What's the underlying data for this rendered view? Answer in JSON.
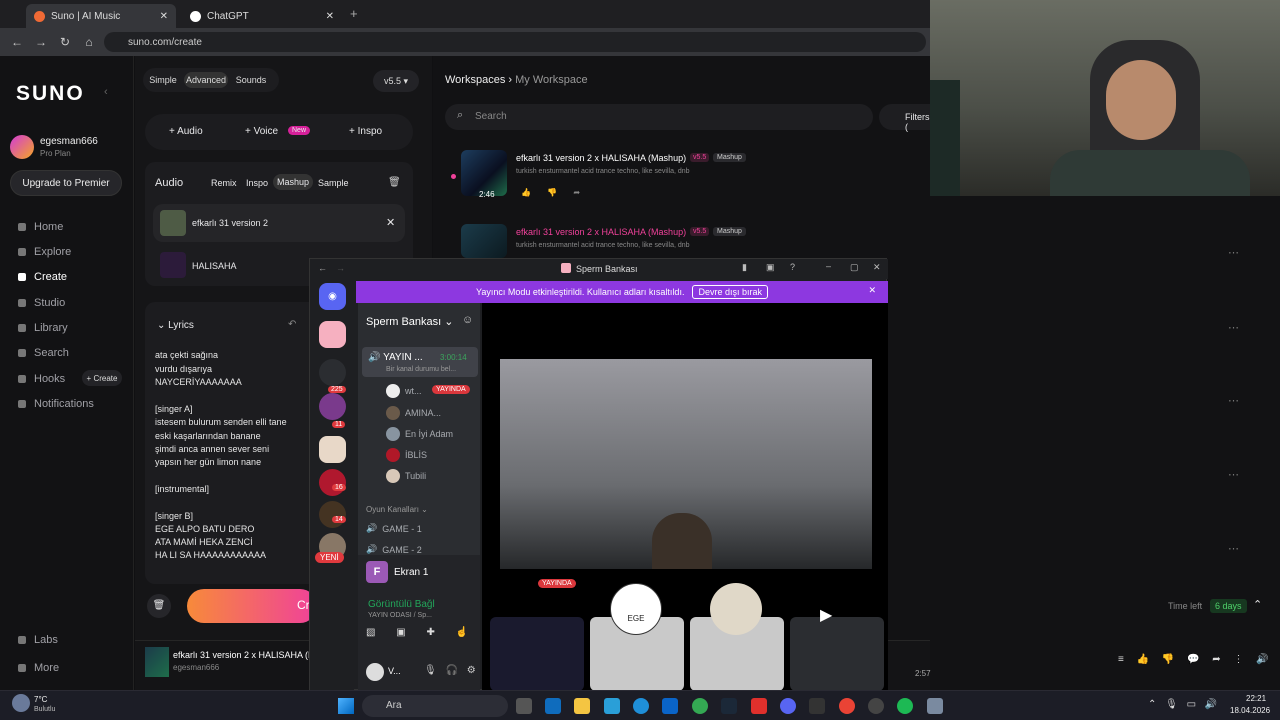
{
  "browser": {
    "tabs": [
      {
        "label": "Suno | AI Music"
      },
      {
        "label": "ChatGPT"
      }
    ],
    "url": "suno.com/create"
  },
  "suno": {
    "logo": "SUNO",
    "user": {
      "name": "egesman666",
      "plan": "Pro Plan"
    },
    "upgrade": "Upgrade to Premier",
    "nav": [
      "Home",
      "Explore",
      "Create",
      "Studio",
      "Library",
      "Search",
      "Hooks",
      "Notifications"
    ],
    "hooks_create": "+ Create",
    "labs": "Labs",
    "more": "More",
    "modes": [
      "Simple",
      "Advanced",
      "Sounds"
    ],
    "version": "v5.5",
    "add": {
      "audio": "+ Audio",
      "voice": "+ Voice",
      "voice_badge": "New",
      "inspo": "+ Inspo"
    },
    "audio_card": {
      "title": "Audio",
      "tabs": [
        "Remix",
        "Inspo",
        "Mashup",
        "Sample"
      ],
      "tracks": [
        "efkarlı 31 version 2",
        "HALISAHA"
      ]
    },
    "lyrics_title": "Lyrics",
    "lyrics": [
      "ata çekti sağına",
      "vurdu dışarıya",
      "NAYCERİYAAAAAAA",
      "",
      "[singer A]",
      "istesem bulurum senden elli tane",
      "eski kaşarlarından banane",
      "şimdi anca annen sever seni",
      "yapsın her gün limon nane",
      "",
      "[instrumental]",
      "",
      "[singer B]",
      "EGE ALPO BATU DERO",
      "ATA MAMİ HEKA ZENCİ",
      "HA LI SA HAAAAAAAAAAA"
    ],
    "create_btn": "Cr"
  },
  "workspace": {
    "crumb_root": "Workspaces",
    "crumb_current": "My Workspace",
    "search": "Search",
    "filters": "Filters (",
    "songs": [
      {
        "title": "efkarlı 31 version 2 x HALISAHA (Mashup)",
        "ver": "v5.5",
        "tag": "Mashup",
        "desc": "turkish ensturmantel acid trance techno, like sevilla, dnb",
        "dur": "2:46"
      },
      {
        "title": "efkarlı 31 version 2 x HALISAHA (Mashup)",
        "ver": "v5.5",
        "tag": "Mashup",
        "desc": "turkish ensturmantel acid trance techno, like sevilla, dnb",
        "dur": ""
      }
    ],
    "time_left": "Time left",
    "days": "6 days"
  },
  "player": {
    "title": "efkarlı 31 version 2 x HALISAHA (M",
    "artist": "egesman666",
    "time": "2:57"
  },
  "discord": {
    "title": "Sperm Bankası",
    "banner": "Yayıncı Modu etkinleştirildi. Kullanıcı adları kısaltıldı.",
    "banner_btn": "Devre dışı bırak",
    "server": "Sperm Bankası",
    "voice_channel": "YAYIN ...",
    "vc_time": "3:00:14",
    "vc_status": "Bir kanal durumu bel...",
    "members": [
      "wt...",
      "AMINA...",
      "En İyi Adam",
      "İBLİS",
      "Tubili"
    ],
    "live": "YAYINDA",
    "category": "Oyun Kanalları",
    "channels": [
      "GAME - 1",
      "GAME - 2"
    ],
    "badges": [
      "225",
      "11",
      "16",
      "14"
    ],
    "new": "YENİ",
    "screen": "Ekran 1",
    "connected": "Görüntülü Bağl",
    "conn_sub": "YAYIN ODASI / Sp...",
    "user": "V...",
    "tile_labels": [
      "YAYINDA",
      "EGE"
    ]
  },
  "taskbar": {
    "weather": "7°C",
    "weather_sub": "Bulutlu",
    "search": "Ara",
    "time": "22:21",
    "date": "18.04.2026"
  },
  "colors": {
    "accent": "#f0419a",
    "new_badge": "#d6209a",
    "discord_banner": "#8d38e0",
    "green": "#23a55a"
  }
}
